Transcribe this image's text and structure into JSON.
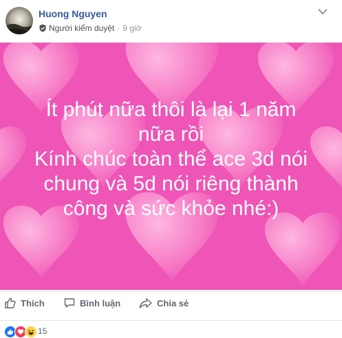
{
  "post": {
    "author": "Huong Nguyen",
    "role": "Người kiểm duyệt",
    "separator": "·",
    "time": "9 giờ",
    "text_lines": [
      "Ít phút nữa thôi là lại 1 năm",
      "nữa rồi",
      "Kính chúc toàn thể ace 3d nói",
      "chung và 5d nói riêng thành",
      "công và sức khỏe nhé:)"
    ],
    "background_color": "#ee55b6"
  },
  "actions": {
    "like": "Thích",
    "comment": "Bình luận",
    "share": "Chia sẻ"
  },
  "reactions": {
    "icons": [
      "like-icon",
      "love-icon",
      "haha-icon"
    ],
    "count": "15"
  },
  "colors": {
    "author": "#365899",
    "like_blue": "#1877f2",
    "love_red": "#f33e58",
    "haha_yellow": "#fcd64a"
  }
}
